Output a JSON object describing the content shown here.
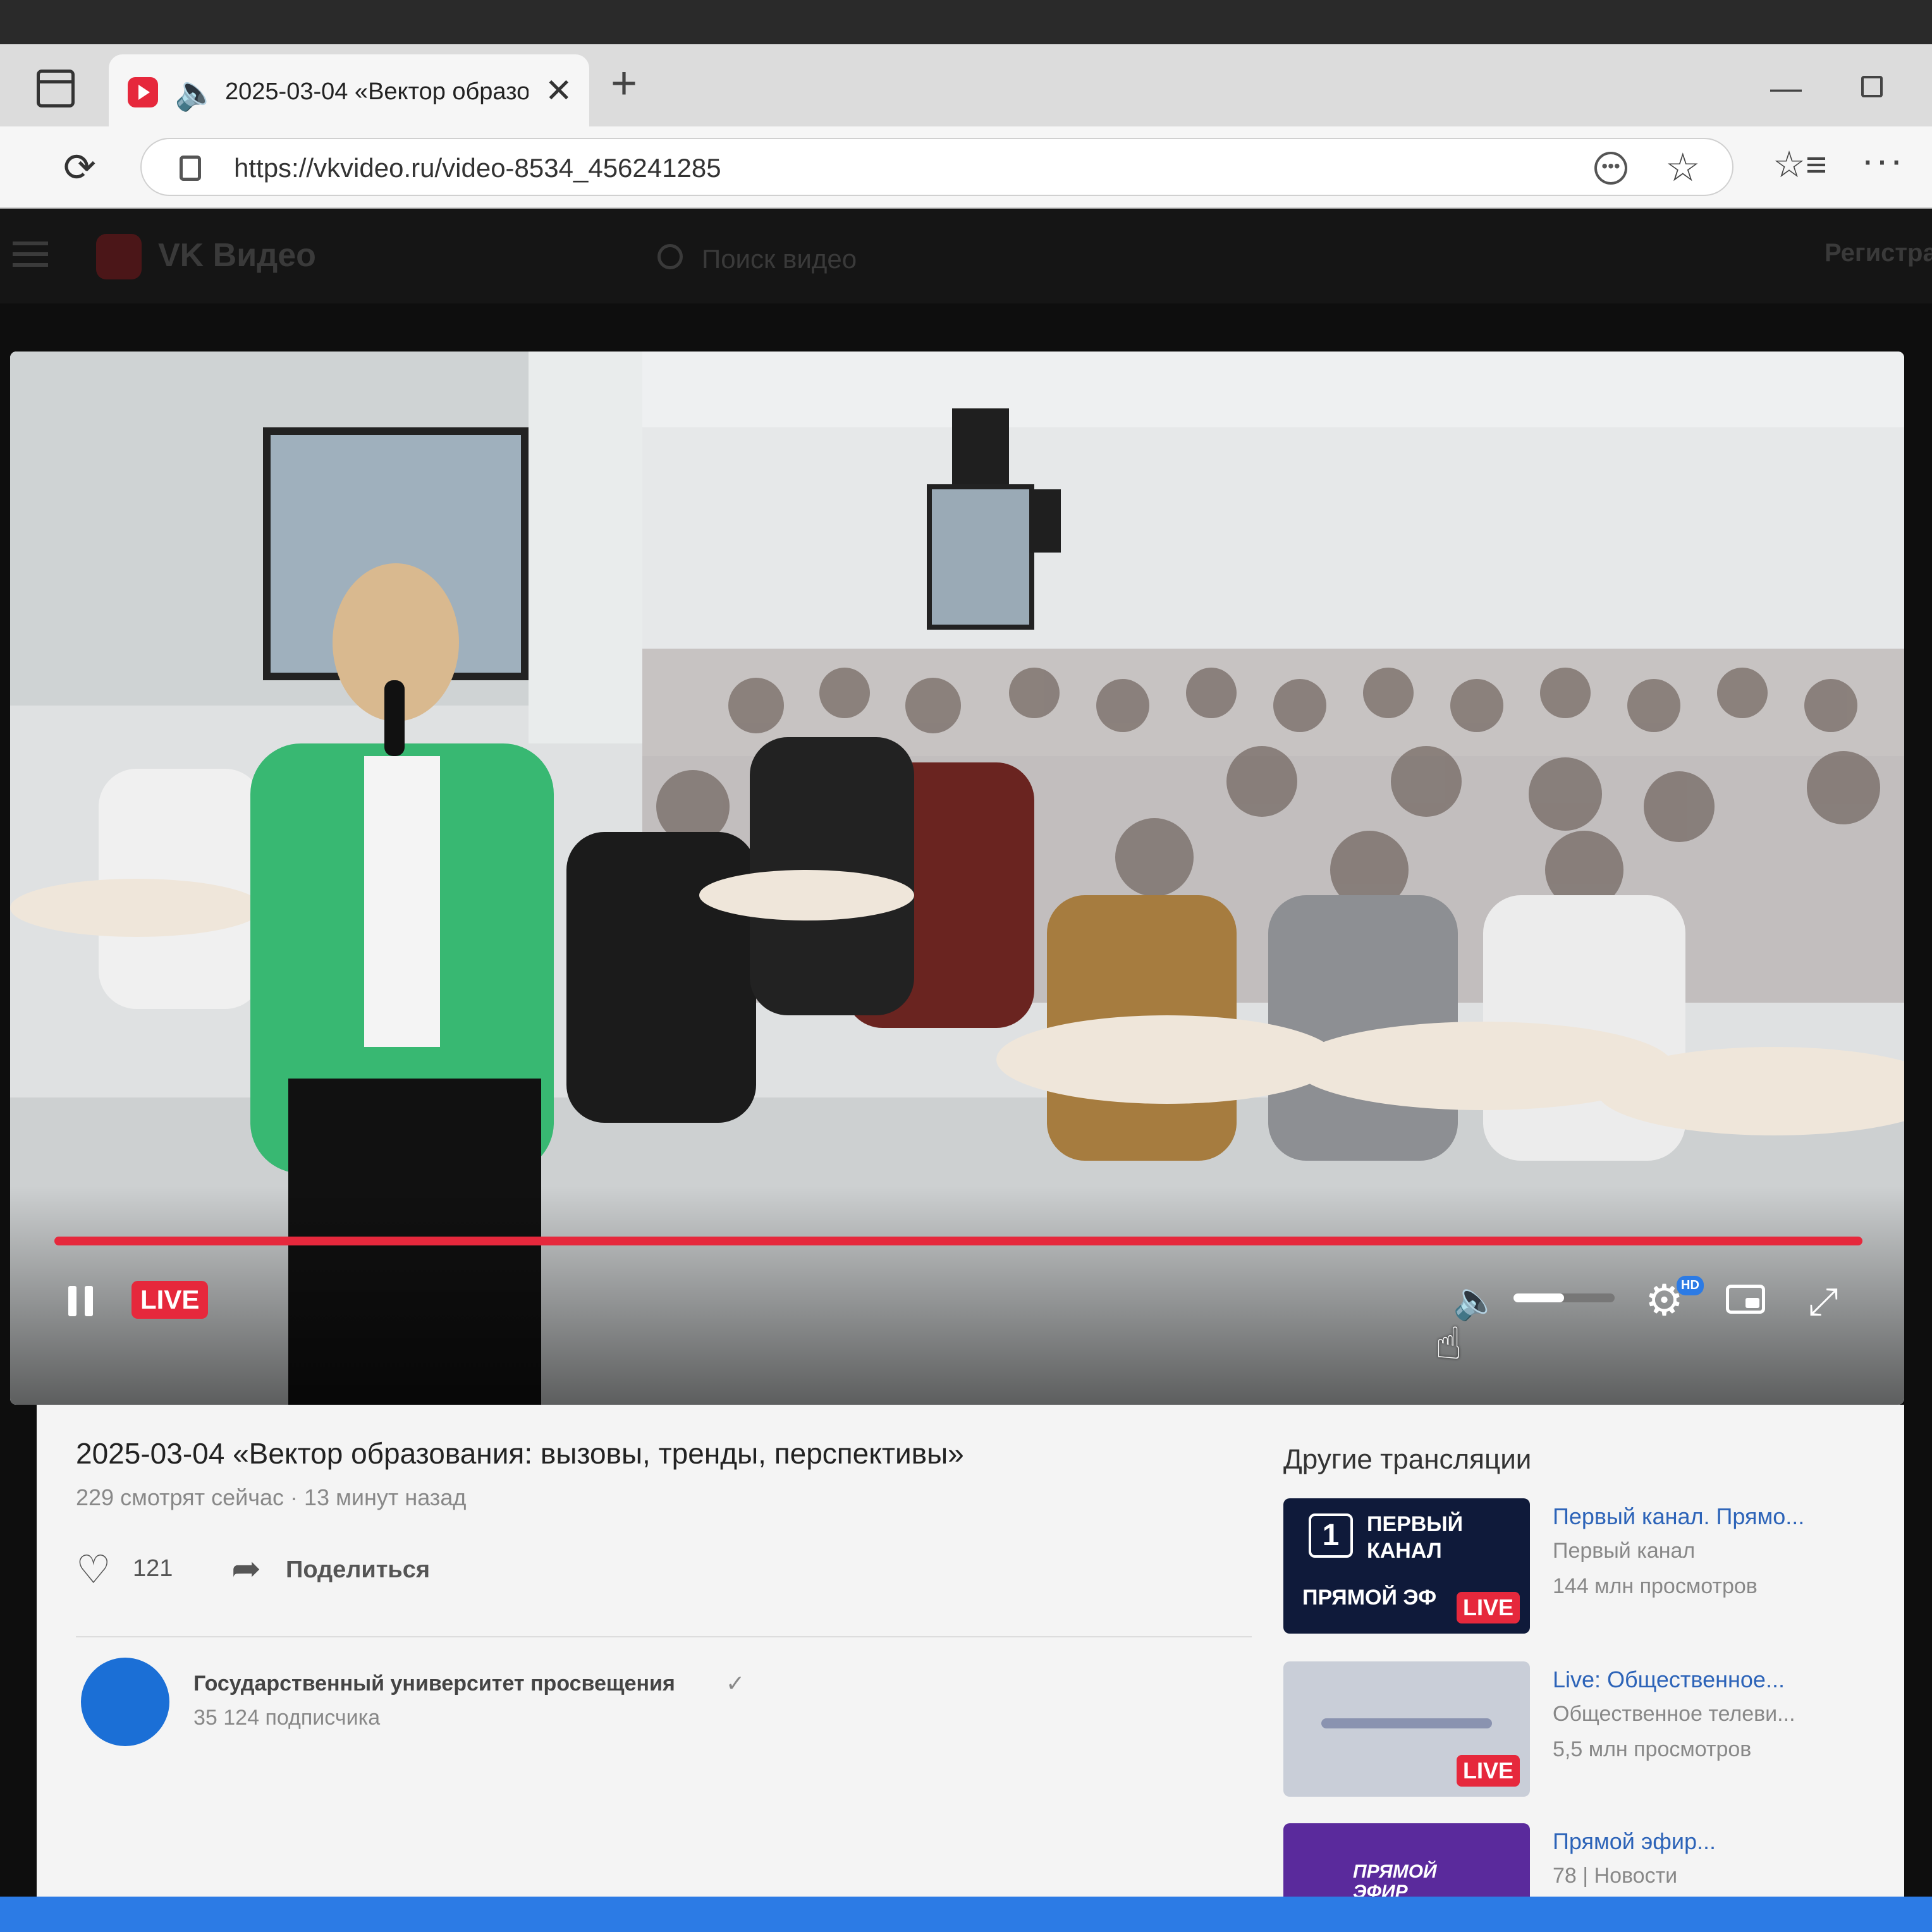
{
  "browser": {
    "tab_title": "2025-03-04 «Вектор образо",
    "url": "https://vkvideo.ru/video-8534_456241285",
    "icons": [
      "sidebar-icon",
      "vk-favicon",
      "speaker-icon",
      "close-icon",
      "plus-icon",
      "reload-icon",
      "lock-icon",
      "more-icon",
      "star-icon",
      "favorites-icon",
      "menu-icon"
    ]
  },
  "vk_header": {
    "logo": "VK Видео",
    "search_placeholder": "Поиск видео",
    "register": "Регистра"
  },
  "player": {
    "live_label": "LIVE",
    "hd_label": "HD",
    "progress_fraction": 1.0,
    "volume_fraction": 0.5,
    "accent_color": "#e6283c"
  },
  "video": {
    "title": "2025-03-04 «Вектор образования: вызовы, тренды, перспективы»",
    "meta": "229 смотрят сейчас · 13 минут назад",
    "likes": "121",
    "share_label": "Поделиться",
    "channel_name": "Государственный университет просвещения",
    "channel_subscribers": "35 124 подписчика"
  },
  "related": {
    "heading": "Другие трансляции",
    "items": [
      {
        "title": "Первый канал. Прямо...",
        "channel": "Первый канал",
        "views": "144 млн просмотров",
        "live": "LIVE",
        "thumb_lines": [
          "ПЕРВЫЙ",
          "КАНАЛ",
          "ПРЯМОЙ ЭФ"
        ]
      },
      {
        "title": "Live: Общественное...",
        "channel": "Общественное телеви...",
        "views": "5,5 млн просмотров",
        "live": "LIVE"
      },
      {
        "title": "Прямой эфир...",
        "channel": "78 | Новости",
        "views": "",
        "thumb_lines": [
          "ПРЯМОЙ",
          "ЭФИР"
        ]
      }
    ]
  }
}
